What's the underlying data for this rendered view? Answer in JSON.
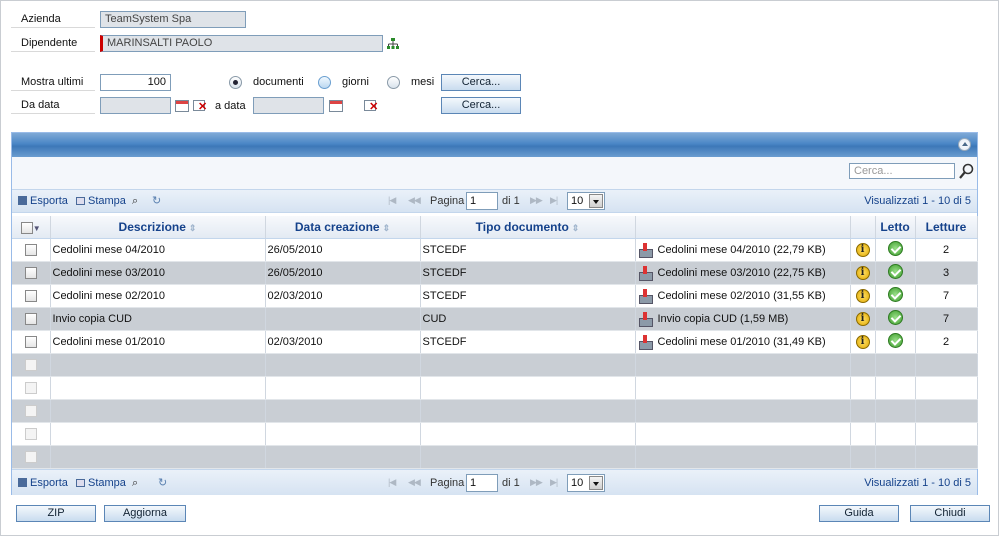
{
  "form": {
    "azienda_label": "Azienda",
    "azienda_value": "TeamSystem Spa",
    "dipendente_label": "Dipendente",
    "dipendente_value": "MARINSALTI PAOLO",
    "mostra_label": "Mostra ultimi",
    "mostra_value": "100",
    "radio_documenti": "documenti",
    "radio_giorni": "giorni",
    "radio_mesi": "mesi",
    "selected_radio": "documenti",
    "cerca_label": "Cerca...",
    "da_data_label": "Da data",
    "a_data_label": "a data",
    "da_data_value": "",
    "a_data_value": ""
  },
  "search": {
    "placeholder": "Cerca..."
  },
  "toolbar": {
    "esporta": "Esporta",
    "stampa": "Stampa",
    "pagina": "Pagina",
    "page_value": "1",
    "di": "di 1",
    "page_size": "10",
    "visualizzati": "Visualizzati 1 - 10 di 5"
  },
  "grid": {
    "headers": [
      "Descrizione",
      "Data creazione",
      "Tipo documento",
      "",
      "",
      "Letto",
      "Letture"
    ],
    "rows": [
      {
        "descrizione": "Cedolini mese 04/2010",
        "data": "26/05/2010",
        "tipo": "STCEDF",
        "file": "Cedolini mese 04/2010 (22,79 KB)",
        "letture": "2"
      },
      {
        "descrizione": "Cedolini mese 03/2010",
        "data": "26/05/2010",
        "tipo": "STCEDF",
        "file": "Cedolini mese 03/2010 (22,75 KB)",
        "letture": "3"
      },
      {
        "descrizione": "Cedolini mese 02/2010",
        "data": "02/03/2010",
        "tipo": "STCEDF",
        "file": "Cedolini mese 02/2010 (31,55 KB)",
        "letture": "7"
      },
      {
        "descrizione": "Invio copia CUD",
        "data": "",
        "tipo": "CUD",
        "file": "Invio copia CUD (1,59 MB)",
        "letture": "7"
      },
      {
        "descrizione": "Cedolini mese 01/2010",
        "data": "02/03/2010",
        "tipo": "STCEDF",
        "file": "Cedolini mese 01/2010 (31,49 KB)",
        "letture": "2"
      }
    ]
  },
  "buttons": {
    "zip": "ZIP",
    "aggiorna": "Aggiorna",
    "guida": "Guida",
    "chiudi": "Chiudi"
  }
}
